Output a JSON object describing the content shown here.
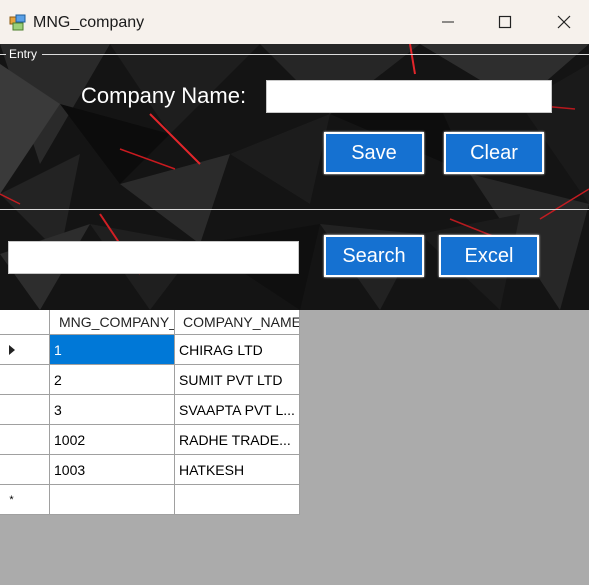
{
  "window": {
    "title": "MNG_company"
  },
  "entry": {
    "legend": "Entry",
    "company_label": "Company Name:",
    "company_value": "",
    "save_label": "Save",
    "clear_label": "Clear"
  },
  "search": {
    "value": "",
    "search_label": "Search",
    "excel_label": "Excel"
  },
  "grid": {
    "columns": [
      "MNG_COMPANY_",
      "COMPANY_NAME"
    ],
    "rows": [
      {
        "id": "1",
        "name": "CHIRAG LTD"
      },
      {
        "id": "2",
        "name": "SUMIT PVT LTD"
      },
      {
        "id": "3",
        "name": "SVAAPTA PVT L..."
      },
      {
        "id": "1002",
        "name": "RADHE TRADE..."
      },
      {
        "id": "1003",
        "name": "HATKESH"
      }
    ],
    "selected_row": 0,
    "new_row_marker": "*"
  },
  "colors": {
    "button_blue": "#1571d1",
    "selection_blue": "#0078d7",
    "background_gray": "#ababab"
  }
}
